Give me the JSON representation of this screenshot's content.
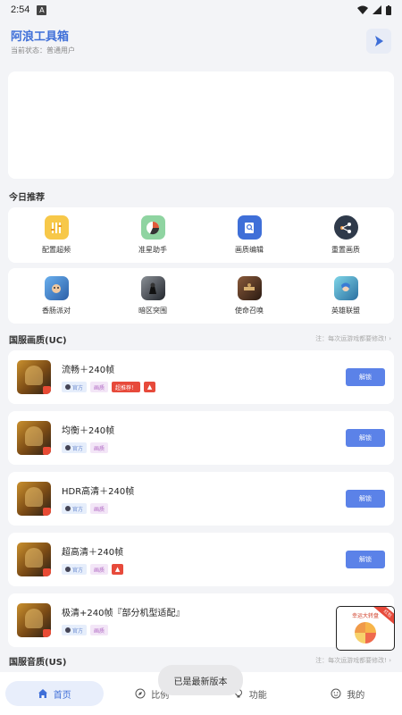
{
  "status": {
    "time": "2:54",
    "a_badge": "A"
  },
  "header": {
    "title": "阿浪工具箱",
    "subtitle": "当前状态：普通用户"
  },
  "today": {
    "title": "今日推荐",
    "row1": [
      {
        "label": "配置超频",
        "icon": "settings-sliders-icon",
        "color": "#f7c849"
      },
      {
        "label": "准星助手",
        "icon": "crosshair-pie-icon",
        "color": "#8fd4a1"
      },
      {
        "label": "画质编辑",
        "icon": "edit-document-icon",
        "color": "#3f6fd8"
      },
      {
        "label": "重置画质",
        "icon": "share-reset-icon",
        "color": "#2f3a4a"
      }
    ],
    "row2": [
      {
        "label": "香肠派对",
        "icon": "sausage-party-game-icon",
        "color": "#4a8bd6"
      },
      {
        "label": "暗区突围",
        "icon": "arena-breakout-game-icon",
        "color": "#2b2f36"
      },
      {
        "label": "使命召唤",
        "icon": "call-of-duty-game-icon",
        "color": "#5b3a28"
      },
      {
        "label": "英雄联盟",
        "icon": "league-of-legends-game-icon",
        "color": "#3aa2c9"
      }
    ]
  },
  "section_uc": {
    "title": "国服画质(UC)",
    "note": "注：每次运游戏都要修改!"
  },
  "items": [
    {
      "title": "流畅＋240帧",
      "tags": [
        "官方",
        "画质"
      ],
      "hot": "超推荐！",
      "fire": true,
      "button": "解锁"
    },
    {
      "title": "均衡＋240帧",
      "tags": [
        "官方",
        "画质"
      ],
      "hot": "",
      "fire": false,
      "button": "解锁"
    },
    {
      "title": "HDR高清＋240帧",
      "tags": [
        "官方",
        "画质"
      ],
      "hot": "",
      "fire": false,
      "button": "解锁"
    },
    {
      "title": "超高清＋240帧",
      "tags": [
        "官方",
        "画质"
      ],
      "hot": "",
      "fire": true,
      "button": "解锁"
    },
    {
      "title": "极清+240帧『部分机型适配』",
      "tags": [
        "官方",
        "画质"
      ],
      "hot": "",
      "fire": false,
      "button": ""
    }
  ],
  "ad": {
    "title": "幸运大转盘",
    "ribbon": "红包"
  },
  "section_us": {
    "title": "国服音质(US)",
    "note": "注：每次运游戏都要修改!"
  },
  "toast": "已是最新版本",
  "tabs": [
    {
      "label": "首页",
      "icon": "home-icon",
      "active": true
    },
    {
      "label": "比例",
      "icon": "compass-icon",
      "active": false
    },
    {
      "label": "功能",
      "icon": "bulb-icon",
      "active": false
    },
    {
      "label": "我的",
      "icon": "smile-icon",
      "active": false
    }
  ],
  "colors": {
    "accent": "#3f6fd8",
    "button": "#5b82e8",
    "hot": "#e74a3b",
    "background": "#f3f4f7"
  }
}
